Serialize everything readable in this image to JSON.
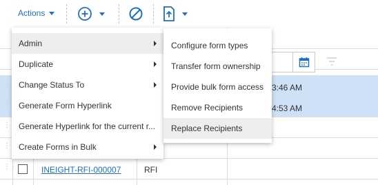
{
  "toolbar": {
    "actions_label": "Actions",
    "icons": [
      "chevron-down-icon",
      "add-circle-icon",
      "block-icon",
      "export-file-icon"
    ]
  },
  "grid": {
    "rows": [
      {
        "time": "3:46 AM",
        "selected": true
      },
      {
        "time": "4:53 AM",
        "selected": true
      },
      {
        "id": "INEIGHT-RFI-000007",
        "type": "RFI",
        "selected": false
      }
    ]
  },
  "actions_menu": {
    "items": [
      {
        "label": "Admin",
        "submenu": true,
        "highlighted": true
      },
      {
        "label": "Duplicate",
        "submenu": true
      },
      {
        "label": "Change Status To",
        "submenu": true
      },
      {
        "label": "Generate Form Hyperlink",
        "submenu": false
      },
      {
        "label": "Generate Hyperlink for the current r...",
        "submenu": false
      },
      {
        "label": "Create Forms in Bulk",
        "submenu": true
      }
    ]
  },
  "admin_submenu": {
    "items": [
      {
        "label": "Configure form types"
      },
      {
        "label": "Transfer form ownership"
      },
      {
        "label": "Provide bulk form access"
      },
      {
        "label": "Remove Recipients"
      },
      {
        "label": "Replace Recipients",
        "highlighted": true
      }
    ]
  },
  "colors": {
    "accent": "#1e6fc0",
    "selected_row": "#cfe1f7",
    "menu_highlight": "#eeeeee"
  }
}
